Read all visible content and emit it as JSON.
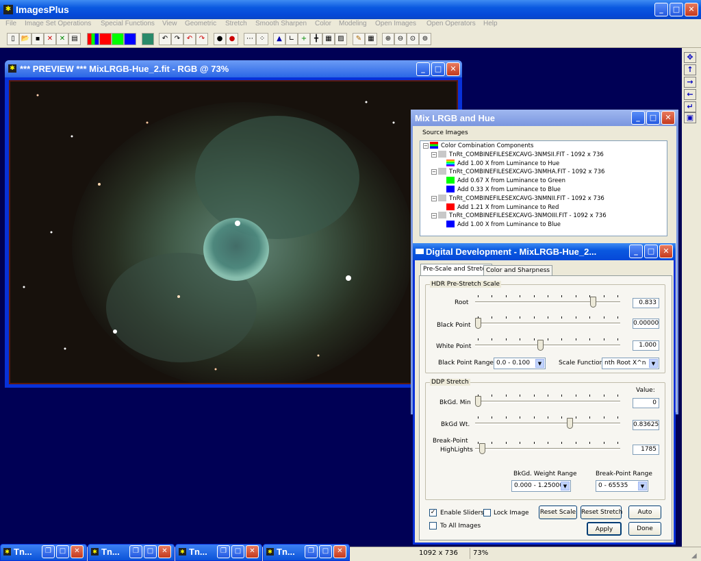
{
  "app": {
    "title": "ImagesPlus"
  },
  "menu": [
    "File",
    "Image Set Operations",
    "Special Functions",
    "View",
    "Geometric",
    "Stretch",
    "Smooth Sharpen",
    "Color",
    "Modeling",
    "Open Images",
    "Open Operators",
    "Help"
  ],
  "toolbar": {
    "icons": [
      "new-icon",
      "open-icon",
      "save-icon",
      "close-red-icon",
      "close-green-icon",
      "print-icon",
      "rgb-bars-icon",
      "red-square-icon",
      "green-square-icon",
      "blue-square-icon",
      "grid-icon",
      "undo-icon",
      "redo-icon",
      "undo-red-icon",
      "redo-red-icon",
      "circle-dark-icon",
      "circle-red-icon",
      "dots-icon",
      "points-icon",
      "histogram-icon",
      "axes-icon",
      "crosshair-plus-icon",
      "crosshair-icon",
      "calculator-icon",
      "image-edit-icon",
      "pencil-icon",
      "table-icon",
      "zoom-in-icon",
      "zoom-out-icon",
      "zoom-fit-icon",
      "zoom-actual-icon"
    ]
  },
  "preview": {
    "title": "*** PREVIEW *** MixLRGB-Hue_2.fit - RGB @ 73%"
  },
  "mix": {
    "title": "Mix LRGB and Hue",
    "group": "Source Images",
    "tree": [
      {
        "text": "Color Combination Components",
        "swatch": "rgb",
        "level": 0
      },
      {
        "text": "TnRt_COMBINEFILESEXCAVG-3NMSII.FIT - 1092 x 736",
        "swatch": "gray",
        "level": 1
      },
      {
        "text": "Add 1.00 X from Luminance to Hue",
        "swatch": "hue",
        "level": 2
      },
      {
        "text": "TnRt_COMBINEFILESEXCAVG-3NMHA.FIT - 1092 x 736",
        "swatch": "gray",
        "level": 1
      },
      {
        "text": "Add 0.67 X from Luminance to Green",
        "swatch": "#00ff00",
        "level": 2
      },
      {
        "text": "Add 0.33 X from Luminance to Blue",
        "swatch": "#0000ff",
        "level": 2
      },
      {
        "text": "TnRt_COMBINEFILESEXCAVG-3NMNII.FIT - 1092 x 736",
        "swatch": "gray",
        "level": 1
      },
      {
        "text": "Add 1.21 X from Luminance to Red",
        "swatch": "#ff0000",
        "level": 2
      },
      {
        "text": "TnRt_COMBINEFILESEXCAVG-3NMOIII.FIT - 1092 x 736",
        "swatch": "gray",
        "level": 1
      },
      {
        "text": "Add 1.00 X from Luminance to Blue",
        "swatch": "#0000ff",
        "level": 2
      }
    ]
  },
  "ddp": {
    "title": "Digital Development - MixLRGB-Hue_2...",
    "tabs": [
      "Pre-Scale and Stretch",
      "Color and Sharpness"
    ],
    "hdr": {
      "label": "HDR Pre-Stretch Scale",
      "root": {
        "label": "Root",
        "value": "0.833",
        "pos": 0.83
      },
      "black": {
        "label": "Black Point",
        "value": "0.00000",
        "pos": 0.0
      },
      "white": {
        "label": "White Point",
        "value": "1.000",
        "pos": 0.45
      },
      "range_label": "Black Point Range",
      "range_value": "0.0 - 0.100",
      "func_label": "Scale Function",
      "func_value": "nth Root X^n"
    },
    "stretch": {
      "label": "DDP Stretch",
      "value_header": "Value:",
      "bkgd_min": {
        "label": "BkGd. Min",
        "value": "0",
        "pos": 0.0
      },
      "bkgd_wt": {
        "label": "BkGd Wt.",
        "value": "0.83625",
        "pos": 0.66
      },
      "bp_label_1": "Break-Point",
      "bp_label_2": "HighLights",
      "bp": {
        "value": "1785",
        "pos": 0.03
      },
      "wt_range_label": "BkGd. Weight Range",
      "wt_range_value": "0.000 - 1.25000",
      "bp_range_label": "Break-Point Range",
      "bp_range_value": "0 - 65535"
    },
    "enable_sliders": "Enable Sliders",
    "lock_image": "Lock Image",
    "to_all_images": "To All Images",
    "reset_scale": "Reset Scale",
    "reset_stretch": "Reset Stretch",
    "auto": "Auto",
    "apply": "Apply",
    "done": "Done"
  },
  "status": {
    "dims": "1092 x 736",
    "zoom": "73%"
  },
  "taskbar": [
    "Tn...",
    "Tn...",
    "Tn...",
    "Tn..."
  ],
  "side_icons": [
    "move-icon",
    "arrow-up-icon",
    "arrow-right-icon",
    "arrow-left-icon",
    "arrow-down-left-icon",
    "copy-icon"
  ]
}
